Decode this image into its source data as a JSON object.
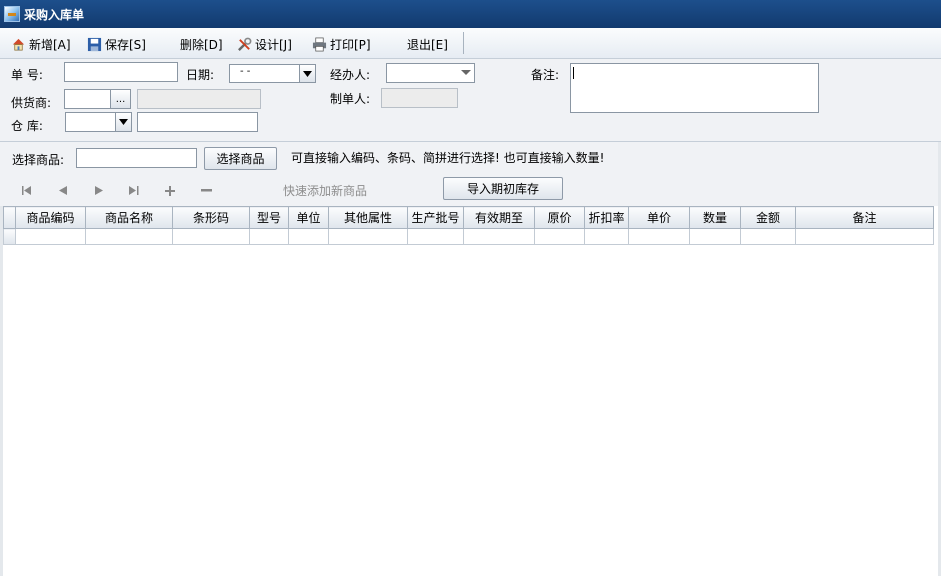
{
  "window": {
    "title": "采购入库单"
  },
  "toolbar": {
    "new": "新增[A]",
    "save": "保存[S]",
    "delete": "删除[D]",
    "design": "设计[J]",
    "print": "打印[P]",
    "exit": "退出[E]"
  },
  "form": {
    "order_no_label": "单    号:",
    "date_label": "日期:",
    "date_value": " - -",
    "handler_label": "经办人:",
    "remark_label": "备注:",
    "supplier_label": "供货商:",
    "creator_label": "制单人:",
    "warehouse_label": "仓    库:",
    "dots": "..."
  },
  "select": {
    "label": "选择商品:",
    "button": "选择商品",
    "hint": "可直接输入编码、条码、简拼进行选择! 也可直接输入数量!",
    "quick_add": "快速添加新商品",
    "import_button": "导入期初库存"
  },
  "grid": {
    "columns": [
      "商品编码",
      "商品名称",
      "条形码",
      "型号",
      "单位",
      "其他属性",
      "生产批号",
      "有效期至",
      "原价",
      "折扣率",
      "单价",
      "数量",
      "金额",
      "备注"
    ]
  }
}
